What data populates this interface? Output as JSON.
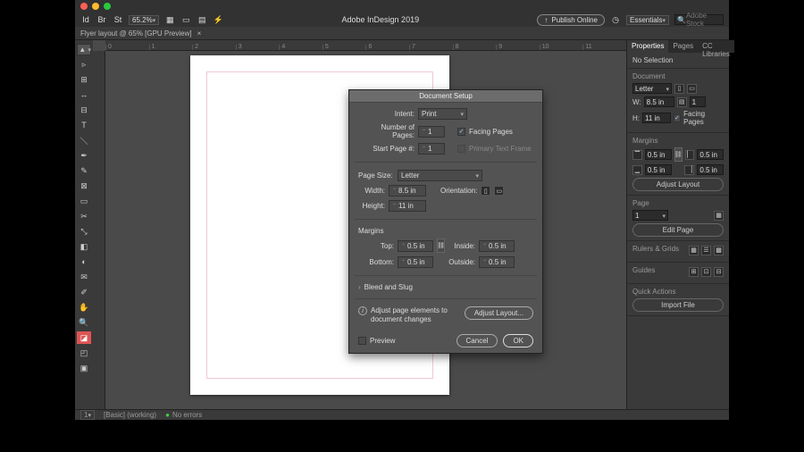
{
  "app": {
    "title": "Adobe InDesign 2019",
    "zoom": "65.2%",
    "publish": "Publish Online",
    "workspace": "Essentials",
    "search_placeholder": "Adobe Stock"
  },
  "tab": {
    "label": "Flyer layout @ 65% [GPU Preview]"
  },
  "ruler": {
    "marks": [
      "0",
      "1",
      "2",
      "3",
      "4",
      "5",
      "6",
      "7",
      "8",
      "9",
      "10",
      "11"
    ]
  },
  "status": {
    "pages": "1",
    "doc": "[Basic] (working)",
    "errors": "No errors"
  },
  "panel": {
    "tabs": {
      "properties": "Properties",
      "pages": "Pages",
      "cc": "CC Libraries"
    },
    "no_selection": "No Selection",
    "doc_head": "Document",
    "page_size": "Letter",
    "pages_field": "1",
    "w_label": "W:",
    "w_val": "8.5 in",
    "h_label": "H:",
    "h_val": "11 in",
    "facing": "Facing Pages",
    "margins_head": "Margins",
    "m_val": "0.5 in",
    "adjust_layout": "Adjust Layout",
    "page_head": "Page",
    "page_num": "1",
    "edit_page": "Edit Page",
    "rulers": "Rulers & Grids",
    "guides": "Guides",
    "quick": "Quick Actions",
    "import": "Import File"
  },
  "dialog": {
    "title": "Document Setup",
    "intent_l": "Intent:",
    "intent_v": "Print",
    "nop_l": "Number of Pages:",
    "nop_v": "1",
    "sp_l": "Start Page #:",
    "sp_v": "1",
    "facing": "Facing Pages",
    "ptf": "Primary Text Frame",
    "ps_l": "Page Size:",
    "ps_v": "Letter",
    "w_l": "Width:",
    "w_v": "8.5 in",
    "h_l": "Height:",
    "h_v": "11 in",
    "orient_l": "Orientation:",
    "margins_head": "Margins",
    "top_l": "Top:",
    "bot_l": "Bottom:",
    "in_l": "Inside:",
    "out_l": "Outside:",
    "m_v": "0.5 in",
    "bleed": "Bleed and Slug",
    "adjust_note": "Adjust page elements to document changes",
    "adjust_btn": "Adjust Layout...",
    "preview": "Preview",
    "cancel": "Cancel",
    "ok": "OK"
  }
}
